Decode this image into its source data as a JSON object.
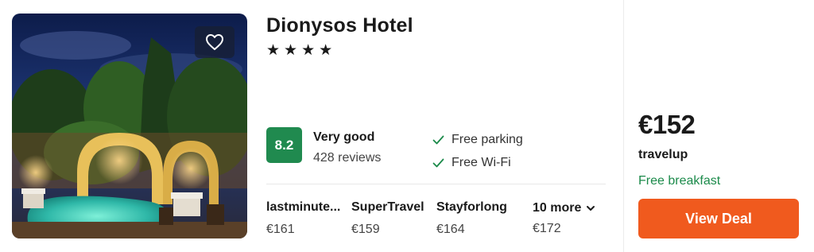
{
  "hotel": {
    "name": "Dionysos Hotel",
    "stars": [
      "★",
      "★",
      "★",
      "★"
    ],
    "score": "8.2",
    "rating_label": "Very good",
    "reviews": "428 reviews",
    "amenities": [
      "Free parking",
      "Free Wi-Fi"
    ]
  },
  "providers": [
    {
      "name": "lastminute...",
      "price": "€161"
    },
    {
      "name": "SuperTravel",
      "price": "€159"
    },
    {
      "name": "Stayforlong",
      "price": "€164"
    }
  ],
  "more": {
    "label": "10 more",
    "price": "€172"
  },
  "deal": {
    "price": "€152",
    "site": "travelup",
    "perk": "Free breakfast",
    "button_label": "View Deal"
  },
  "colors": {
    "score_bg": "#208a4f",
    "perk_text": "#1b8a4a",
    "check": "#1b8a4a",
    "button_bg": "#f05a1e",
    "heart_overlay": "#181e30"
  },
  "icons": {
    "favorite": "heart-outline-icon",
    "amenity": "checkmark-icon",
    "more": "chevron-down-icon"
  }
}
